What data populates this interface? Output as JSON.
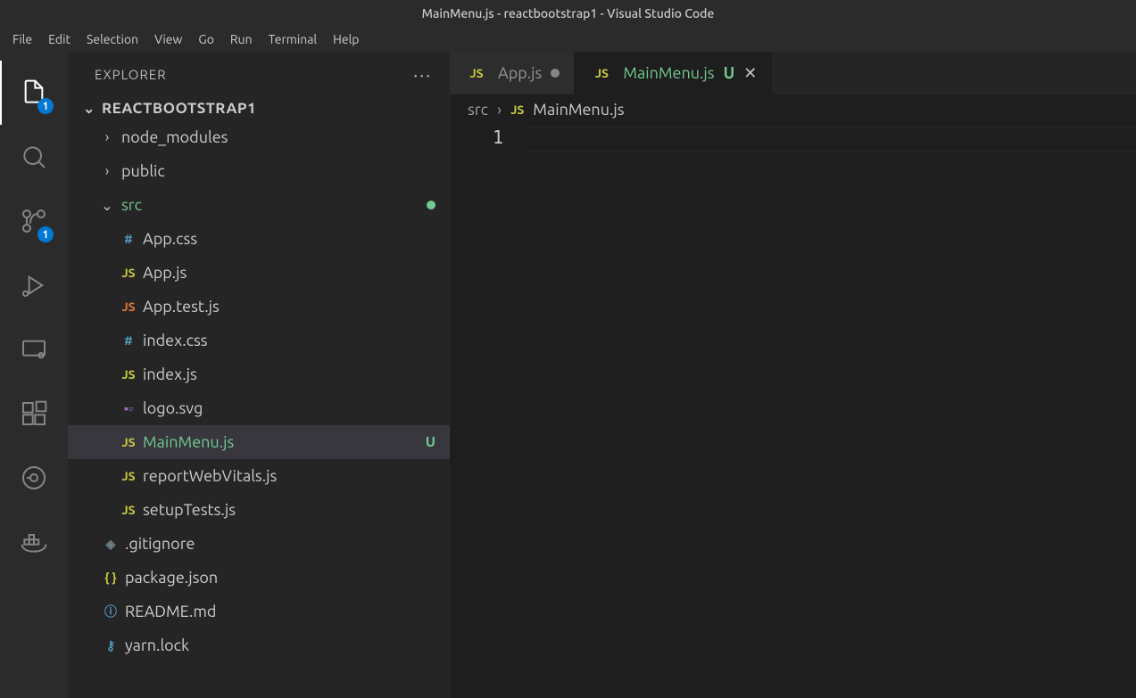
{
  "window": {
    "title": "MainMenu.js - reactbootstrap1 - Visual Studio Code"
  },
  "menu": [
    "File",
    "Edit",
    "Selection",
    "View",
    "Go",
    "Run",
    "Terminal",
    "Help"
  ],
  "activity": {
    "explorer_badge": "1",
    "scm_badge": "1"
  },
  "sidebar": {
    "title": "EXPLORER",
    "root": "REACTBOOTSTRAP1",
    "tree": [
      {
        "type": "folder",
        "name": "node_modules",
        "indent": 1,
        "expanded": false
      },
      {
        "type": "folder",
        "name": "public",
        "indent": 1,
        "expanded": false
      },
      {
        "type": "folder",
        "name": "src",
        "indent": 1,
        "expanded": true,
        "git": "modified",
        "color": "green"
      },
      {
        "type": "file",
        "name": "App.css",
        "indent": 2,
        "icon": "css"
      },
      {
        "type": "file",
        "name": "App.js",
        "indent": 2,
        "icon": "js"
      },
      {
        "type": "file",
        "name": "App.test.js",
        "indent": 2,
        "icon": "js-alt"
      },
      {
        "type": "file",
        "name": "index.css",
        "indent": 2,
        "icon": "css"
      },
      {
        "type": "file",
        "name": "index.js",
        "indent": 2,
        "icon": "js"
      },
      {
        "type": "file",
        "name": "logo.svg",
        "indent": 2,
        "icon": "svg"
      },
      {
        "type": "file",
        "name": "MainMenu.js",
        "indent": 2,
        "icon": "js",
        "selected": true,
        "git": "U",
        "color": "green"
      },
      {
        "type": "file",
        "name": "reportWebVitals.js",
        "indent": 2,
        "icon": "js"
      },
      {
        "type": "file",
        "name": "setupTests.js",
        "indent": 2,
        "icon": "js"
      },
      {
        "type": "file",
        "name": ".gitignore",
        "indent": 1,
        "icon": "git"
      },
      {
        "type": "file",
        "name": "package.json",
        "indent": 1,
        "icon": "json"
      },
      {
        "type": "file",
        "name": "README.md",
        "indent": 1,
        "icon": "info"
      },
      {
        "type": "file",
        "name": "yarn.lock",
        "indent": 1,
        "icon": "yarn"
      }
    ]
  },
  "tabs": [
    {
      "icon": "js",
      "label": "App.js",
      "dirty": true,
      "active": false
    },
    {
      "icon": "js",
      "label": "MainMenu.js",
      "git": "U",
      "active": true,
      "color": "green"
    }
  ],
  "breadcrumbs": {
    "parts": [
      "src",
      "MainMenu.js"
    ],
    "icon": "js"
  },
  "editor": {
    "line_number": "1"
  }
}
